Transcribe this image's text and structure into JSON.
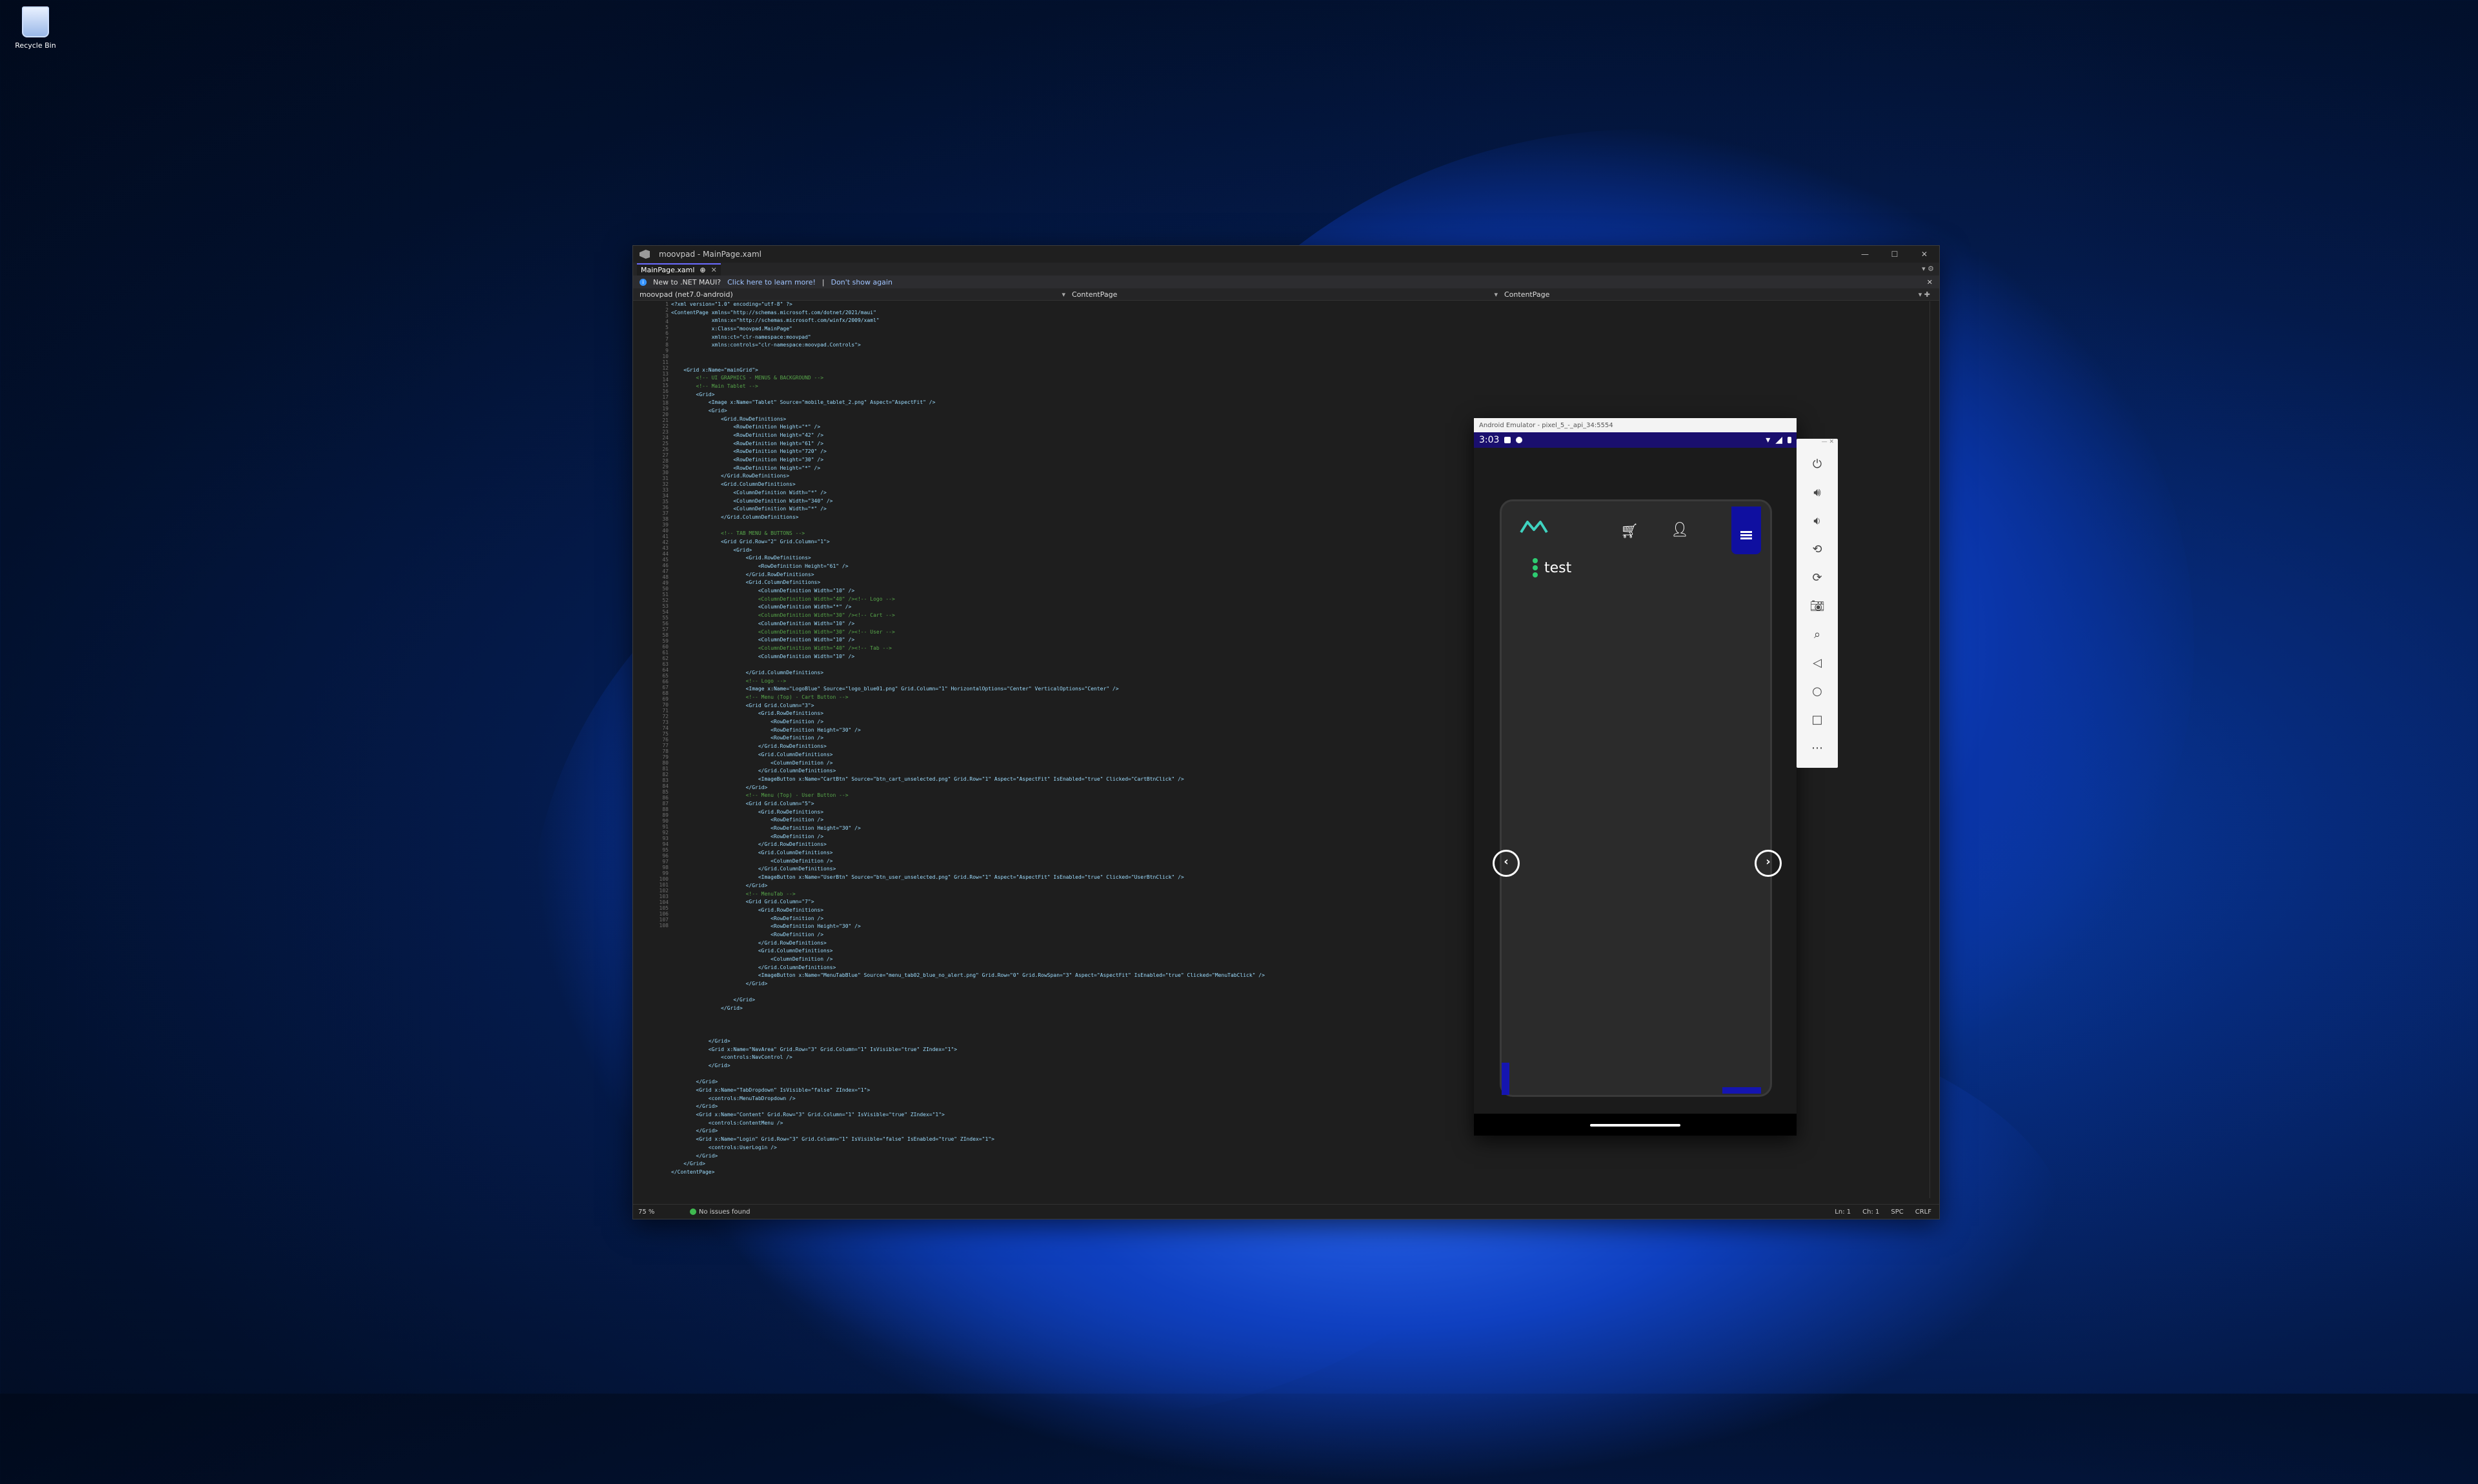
{
  "desktop": {
    "recycle_bin_label": "Recycle Bin"
  },
  "vs": {
    "title": "moovpad - MainPage.xaml",
    "tab_label": "MainPage.xaml",
    "infobar": {
      "text": "New to .NET MAUI?",
      "link1": "Click here to learn more!",
      "sep": "|",
      "link2": "Don't show again"
    },
    "nav": {
      "project": "moovpad (net7.0-android)",
      "scope1": "ContentPage",
      "scope2": "ContentPage"
    },
    "status": {
      "zoom": "75 %",
      "issues": "No issues found",
      "ln": "Ln: 1",
      "ch": "Ch: 1",
      "spc": "SPC",
      "crlf": "CRLF"
    },
    "code_lines": [
      "<?xml version=\"1.0\" encoding=\"utf-8\" ?>",
      "<ContentPage xmlns=\"http://schemas.microsoft.com/dotnet/2021/maui\"",
      "             xmlns:x=\"http://schemas.microsoft.com/winfx/2009/xaml\"",
      "             x:Class=\"moovpad.MainPage\"",
      "             xmlns:ct=\"clr-namespace:moovpad\"",
      "             xmlns:controls=\"clr-namespace:moovpad.Controls\">",
      "",
      "",
      "    <Grid x:Name=\"mainGrid\">",
      "        <!-- UI GRAPHICS - MENUS & BACKGROUND -->",
      "        <!-- Main Tablet -->",
      "        <Grid>",
      "            <Image x:Name=\"Tablet\" Source=\"mobile_tablet_2.png\" Aspect=\"AspectFit\" />",
      "            <Grid>",
      "                <Grid.RowDefinitions>",
      "                    <RowDefinition Height=\"*\" />",
      "                    <RowDefinition Height=\"42\" />",
      "                    <RowDefinition Height=\"61\" />",
      "                    <RowDefinition Height=\"720\" />",
      "                    <RowDefinition Height=\"30\" />",
      "                    <RowDefinition Height=\"*\" />",
      "                </Grid.RowDefinitions>",
      "                <Grid.ColumnDefinitions>",
      "                    <ColumnDefinition Width=\"*\" />",
      "                    <ColumnDefinition Width=\"340\" />",
      "                    <ColumnDefinition Width=\"*\" />",
      "                </Grid.ColumnDefinitions>",
      "",
      "                <!-- TAB MENU & BUTTONS -->",
      "                <Grid Grid.Row=\"2\" Grid.Column=\"1\">",
      "                    <Grid>",
      "                        <Grid.RowDefinitions>",
      "                            <RowDefinition Height=\"61\" />",
      "                        </Grid.RowDefinitions>",
      "                        <Grid.ColumnDefinitions>",
      "                            <ColumnDefinition Width=\"10\" />",
      "                            <ColumnDefinition Width=\"40\" /><!-- Logo -->",
      "                            <ColumnDefinition Width=\"*\" />",
      "                            <ColumnDefinition Width=\"30\" /><!-- Cart -->",
      "                            <ColumnDefinition Width=\"10\" />",
      "                            <ColumnDefinition Width=\"30\" /><!-- User -->",
      "                            <ColumnDefinition Width=\"10\" />",
      "                            <ColumnDefinition Width=\"40\" /><!-- Tab -->",
      "                            <ColumnDefinition Width=\"10\" />",
      "",
      "                        </Grid.ColumnDefinitions>",
      "                        <!-- Logo -->",
      "                        <Image x:Name=\"LogoBlue\" Source=\"logo_blue01.png\" Grid.Column=\"1\" HorizontalOptions=\"Center\" VerticalOptions=\"Center\" />",
      "                        <!-- Menu (Top) - Cart Button -->",
      "                        <Grid Grid.Column=\"3\">",
      "                            <Grid.RowDefinitions>",
      "                                <RowDefinition />",
      "                                <RowDefinition Height=\"30\" />",
      "                                <RowDefinition />",
      "                            </Grid.RowDefinitions>",
      "                            <Grid.ColumnDefinitions>",
      "                                <ColumnDefinition />",
      "                            </Grid.ColumnDefinitions>",
      "                            <ImageButton x:Name=\"CartBtn\" Source=\"btn_cart_unselected.png\" Grid.Row=\"1\" Aspect=\"AspectFit\" IsEnabled=\"true\" Clicked=\"CartBtnClick\" />",
      "                        </Grid>",
      "                        <!-- Menu (Top) - User Button -->",
      "                        <Grid Grid.Column=\"5\">",
      "                            <Grid.RowDefinitions>",
      "                                <RowDefinition />",
      "                                <RowDefinition Height=\"30\" />",
      "                                <RowDefinition />",
      "                            </Grid.RowDefinitions>",
      "                            <Grid.ColumnDefinitions>",
      "                                <ColumnDefinition />",
      "                            </Grid.ColumnDefinitions>",
      "                            <ImageButton x:Name=\"UserBtn\" Source=\"btn_user_unselected.png\" Grid.Row=\"1\" Aspect=\"AspectFit\" IsEnabled=\"true\" Clicked=\"UserBtnClick\" />",
      "                        </Grid>",
      "                        <!-- MenuTab -->",
      "                        <Grid Grid.Column=\"7\">",
      "                            <Grid.RowDefinitions>",
      "                                <RowDefinition />",
      "                                <RowDefinition Height=\"30\" />",
      "                                <RowDefinition />",
      "                            </Grid.RowDefinitions>",
      "                            <Grid.ColumnDefinitions>",
      "                                <ColumnDefinition />",
      "                            </Grid.ColumnDefinitions>",
      "                            <ImageButton x:Name=\"MenuTabBlue\" Source=\"menu_tab02_blue_no_alert.png\" Grid.Row=\"0\" Grid.RowSpan=\"3\" Aspect=\"AspectFit\" IsEnabled=\"true\" Clicked=\"MenuTabClick\" />",
      "                        </Grid>",
      "",
      "                    </Grid>",
      "                </Grid>",
      "",
      "",
      "",
      "            </Grid>",
      "            <Grid x:Name=\"NavArea\" Grid.Row=\"3\" Grid.Column=\"1\" IsVisible=\"true\" ZIndex=\"1\">",
      "                <controls:NavControl />",
      "            </Grid>",
      "",
      "        </Grid>",
      "        <Grid x:Name=\"TabDropdown\" IsVisible=\"false\" ZIndex=\"1\">",
      "            <controls:MenuTabDropdown />",
      "        </Grid>",
      "        <Grid x:Name=\"Content\" Grid.Row=\"3\" Grid.Column=\"1\" IsVisible=\"true\" ZIndex=\"1\">",
      "            <controls:ContentMenu />",
      "        </Grid>",
      "        <Grid x:Name=\"Login\" Grid.Row=\"3\" Grid.Column=\"1\" IsVisible=\"false\" IsEnabled=\"true\" ZIndex=\"1\">",
      "            <controls:UserLogin />",
      "        </Grid>",
      "    </Grid>",
      "</ContentPage>",
      ""
    ]
  },
  "emulator": {
    "title": "Android Emulator - pixel_5_-_api_34:5554",
    "time": "3:03",
    "label": "test"
  },
  "colors": {
    "accent": "#1a0f6e",
    "menu_tab": "#0f0fa0",
    "logo": "#3fd3c0"
  }
}
